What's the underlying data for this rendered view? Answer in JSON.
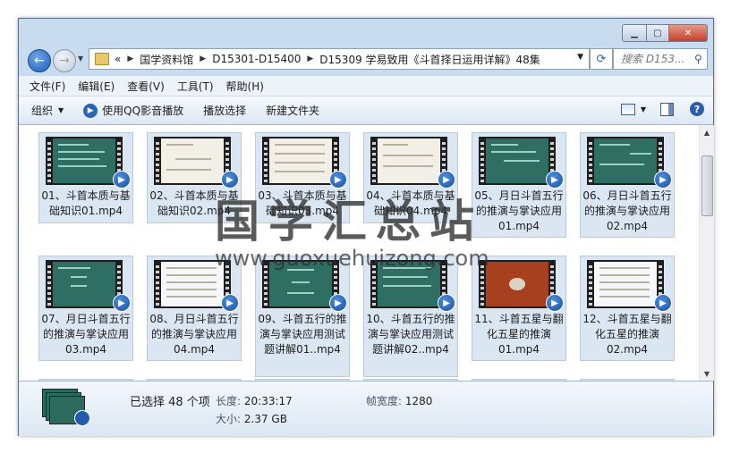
{
  "address": {
    "overflow": "«",
    "crumbs": [
      "国学资料馆",
      "D15301-D15400",
      "D15309 学易致用《斗首择日运用详解》48集"
    ],
    "search_placeholder": "搜索 D153..."
  },
  "menu": [
    "文件(F)",
    "编辑(E)",
    "查看(V)",
    "工具(T)",
    "帮助(H)"
  ],
  "toolbar": {
    "organize": "组织",
    "qq_play": "使用QQ影音播放",
    "play_selection": "播放选择",
    "new_folder": "新建文件夹"
  },
  "files": [
    {
      "name": "01、斗首本质与基础知识01.mp4"
    },
    {
      "name": "02、斗首本质与基础知识02.mp4"
    },
    {
      "name": "03、斗首本质与基础知识03.mp4"
    },
    {
      "name": "04、斗首本质与基础知识04.mp4"
    },
    {
      "name": "05、月日斗首五行的推演与掌诀应用01.mp4"
    },
    {
      "name": "06、月日斗首五行的推演与掌诀应用02.mp4"
    },
    {
      "name": "07、月日斗首五行的推演与掌诀应用03.mp4"
    },
    {
      "name": "08、月日斗首五行的推演与掌诀应用04.mp4"
    },
    {
      "name": "09、斗首五行的推演与掌诀应用测试题讲解01..mp4"
    },
    {
      "name": "10、斗首五行的推演与掌诀应用测试题讲解02..mp4"
    },
    {
      "name": "11、斗首五星与翻化五星的推演01.mp4"
    },
    {
      "name": "12、斗首五星与翻化五星的推演02.mp4"
    }
  ],
  "watermark": {
    "chinese": "国学汇总站",
    "url": "www.guoxuehuizong.com"
  },
  "details": {
    "selected": "已选择 48 个项",
    "length_label": "长度:",
    "length_value": "20:33:17",
    "size_label": "大小:",
    "size_value": "2.37 GB",
    "width_label": "帧宽度:",
    "width_value": "1280"
  }
}
